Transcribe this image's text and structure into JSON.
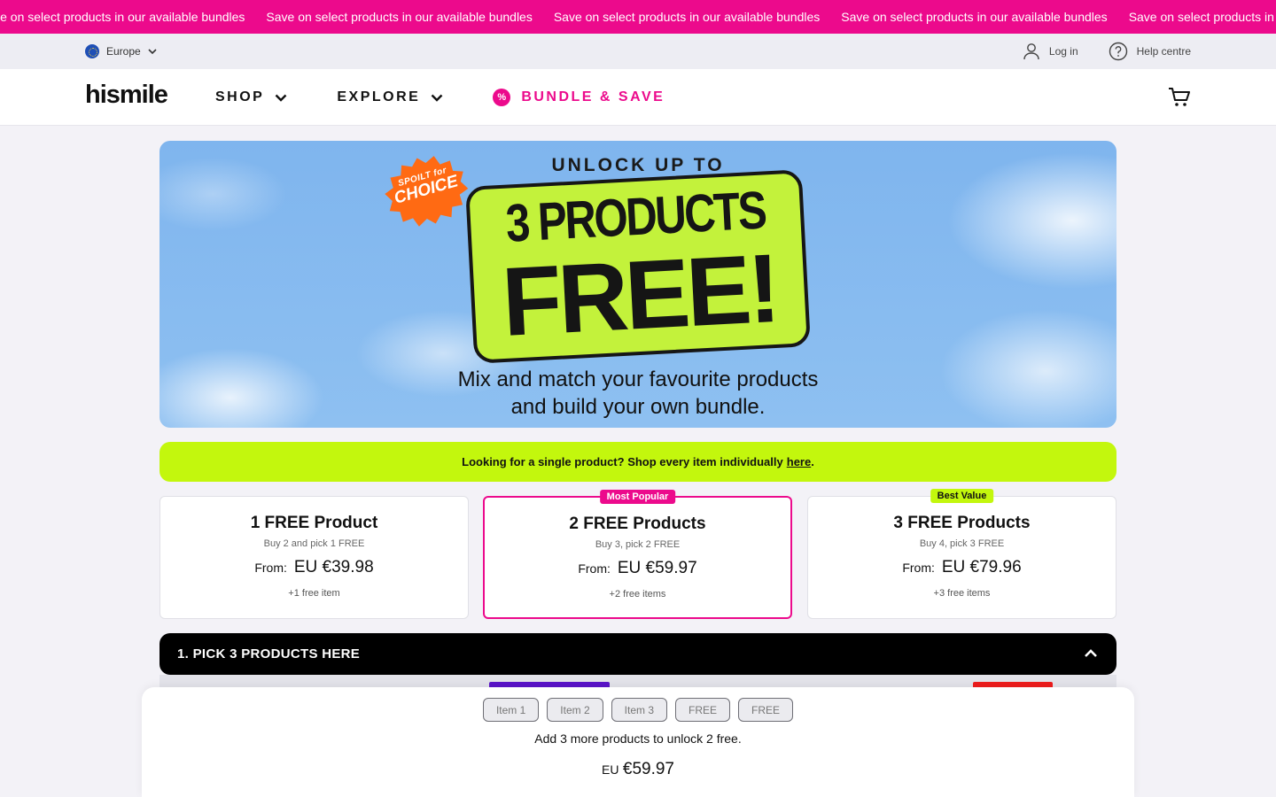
{
  "marquee": {
    "items": [
      "Save on select products in our available bundles",
      "Save on select products in our available bundles",
      "Save on select products in our available bundles",
      "Save on select products in our available bundles",
      "Save on select products in our available bundles"
    ]
  },
  "utility": {
    "region": "Europe",
    "login": "Log in",
    "help": "Help centre"
  },
  "header": {
    "logo": "hismile",
    "nav": [
      {
        "label": "SHOP"
      },
      {
        "label": "EXPLORE"
      },
      {
        "label": "BUNDLE & SAVE",
        "badge": "%"
      }
    ]
  },
  "hero": {
    "eyebrow": "UNLOCK UP TO",
    "sticker_line1": "SPOILT for",
    "sticker_line2": "CHOICE",
    "headline_line1": "3 PRODUCTS",
    "headline_line2": "FREE!",
    "subtitle_line1": "Mix and match your favourite products",
    "subtitle_line2": "and build your own bundle."
  },
  "info_bar": {
    "text": "Looking for a single product? Shop every item individually",
    "link": "here",
    "suffix": "."
  },
  "offers": [
    {
      "title": "1 FREE Product",
      "desc": "Buy 2 and pick 1 FREE",
      "from": "From:",
      "price": "EU €39.98",
      "extra": "+1 free item",
      "tag": ""
    },
    {
      "title": "2 FREE Products",
      "desc": "Buy 3, pick 2 FREE",
      "from": "From:",
      "price": "EU €59.97",
      "extra": "+2 free items",
      "tag": "Most Popular",
      "selected": true
    },
    {
      "title": "3 FREE Products",
      "desc": "Buy 4, pick 3 FREE",
      "from": "From:",
      "price": "EU €79.96",
      "extra": "+3 free items",
      "tag": "Best Value"
    }
  ],
  "accordion": {
    "title": "1. PICK 3 PRODUCTS HERE"
  },
  "tray": {
    "slots": [
      "Item 1",
      "Item 2",
      "Item 3",
      "FREE",
      "FREE"
    ],
    "message": "Add 3 more products to unlock 2 free.",
    "currency": "EU",
    "total": "€59.97"
  },
  "colors": {
    "brand_pink": "#ec0a8c",
    "lime": "#c3f70d",
    "sky": "#8ec0f1"
  }
}
